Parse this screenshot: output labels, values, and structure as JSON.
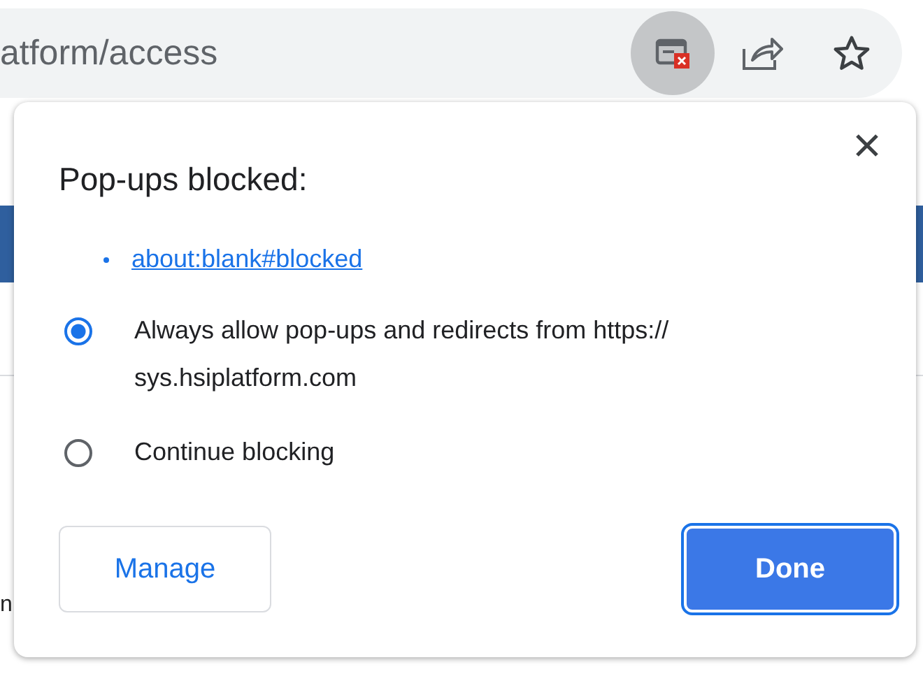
{
  "address_bar": {
    "url": "atform/access"
  },
  "page": {
    "edge_text": "n"
  },
  "popup": {
    "title": "Pop-ups blocked:",
    "blocked_links": [
      "about:blank#blocked"
    ],
    "options": [
      {
        "label": "Always allow pop-ups and redirects from https:// sys.hsiplatform.com",
        "selected": true
      },
      {
        "label": "Continue blocking",
        "selected": false
      }
    ],
    "buttons": [
      {
        "label": "Manage",
        "kind": "secondary"
      },
      {
        "label": "Done",
        "kind": "primary"
      }
    ]
  }
}
